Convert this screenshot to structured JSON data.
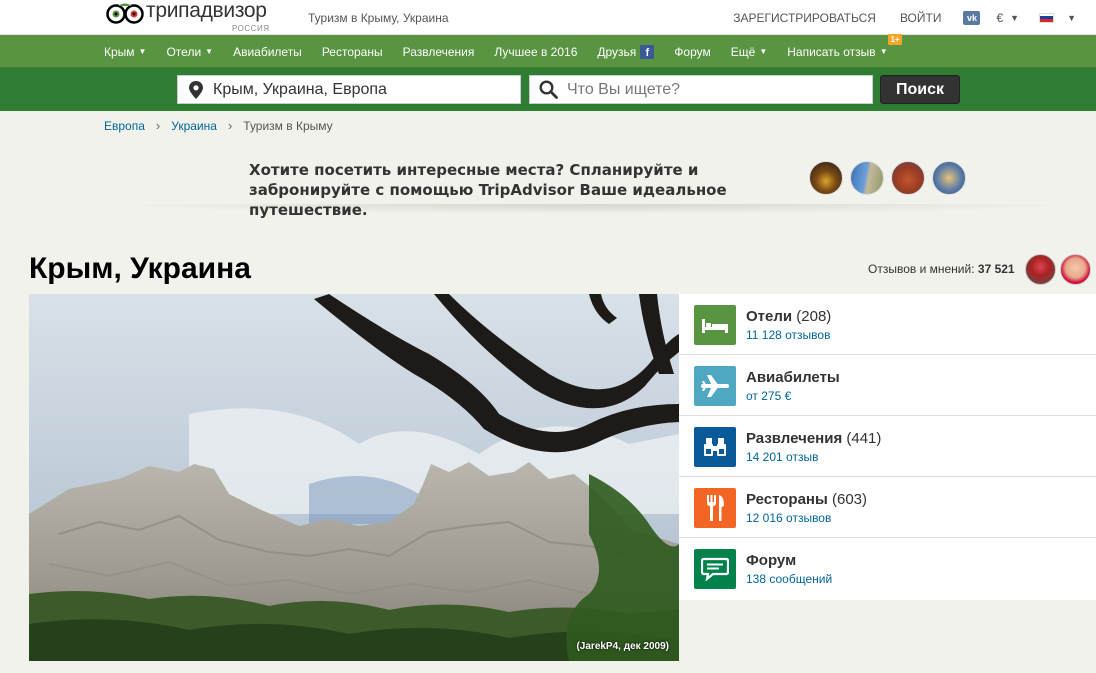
{
  "header": {
    "logo_text": "трипадвизор",
    "logo_sub": "РОССИЯ",
    "tagline": "Туризм в Крыму, Украина",
    "register": "ЗАРЕГИСТРИРОВАТЬСЯ",
    "login": "ВОЙТИ",
    "vk": "vk",
    "currency": "€",
    "language_flag": "russia-flag"
  },
  "nav": {
    "items": [
      {
        "label": "Крым",
        "dropdown": true
      },
      {
        "label": "Отели",
        "dropdown": true
      },
      {
        "label": "Авиабилеты",
        "dropdown": false
      },
      {
        "label": "Рестораны",
        "dropdown": false
      },
      {
        "label": "Развлечения",
        "dropdown": false
      },
      {
        "label": "Лучшее в 2016",
        "dropdown": false
      },
      {
        "label": "Друзья",
        "dropdown": false
      },
      {
        "label": "Форум",
        "dropdown": false
      },
      {
        "label": "Ещё",
        "dropdown": true
      },
      {
        "label": "Написать отзыв",
        "dropdown": true
      }
    ],
    "badge": "1+"
  },
  "search": {
    "where_value": "Крым, Украина, Европа",
    "what_placeholder": "Что Вы ищете?",
    "button": "Поиск"
  },
  "breadcrumb": {
    "items": [
      "Европа",
      "Украина"
    ],
    "separator": "›",
    "current": "Туризм в Крыму"
  },
  "promo": {
    "text": "Хотите посетить интересные места? Спланируйте и забронируйте с помощью TripAdvisor Ваше идеальное путешествие."
  },
  "main": {
    "title": "Крым, Украина",
    "reviews_label": "Отзывов и мнений:",
    "reviews_count": "37 521",
    "photo_credit": "(JarekP4, дек 2009)"
  },
  "categories": [
    {
      "title": "Отели",
      "count": "(208)",
      "sub": "11 128 отзывов",
      "color": "#589442",
      "icon": "bed-icon"
    },
    {
      "title": "Авиабилеты",
      "count": "",
      "sub": "от 275 €",
      "color": "#4fa8c1",
      "icon": "airplane-icon"
    },
    {
      "title": "Развлечения",
      "count": "(441)",
      "sub": "14 201 отзыв",
      "color": "#0a5a9a",
      "icon": "binoculars-icon"
    },
    {
      "title": "Рестораны",
      "count": "(603)",
      "sub": "12 016 отзывов",
      "color": "#f26522",
      "icon": "fork-knife-icon"
    },
    {
      "title": "Форум",
      "count": "",
      "sub": "138 сообщений",
      "color": "#00824a",
      "icon": "chat-icon"
    }
  ],
  "colors": {
    "nav_green": "#589442",
    "search_green": "#2f7d32",
    "link_blue": "#006699"
  }
}
